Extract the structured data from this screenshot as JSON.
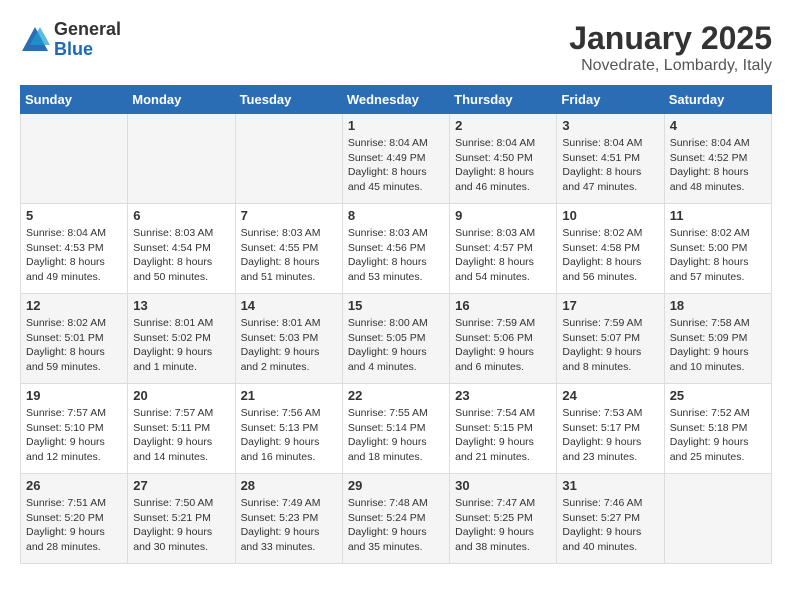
{
  "header": {
    "logo": {
      "general": "General",
      "blue": "Blue"
    },
    "title": "January 2025",
    "location": "Novedrate, Lombardy, Italy"
  },
  "weekdays": [
    "Sunday",
    "Monday",
    "Tuesday",
    "Wednesday",
    "Thursday",
    "Friday",
    "Saturday"
  ],
  "weeks": [
    [
      {
        "day": "",
        "info": ""
      },
      {
        "day": "",
        "info": ""
      },
      {
        "day": "",
        "info": ""
      },
      {
        "day": "1",
        "info": "Sunrise: 8:04 AM\nSunset: 4:49 PM\nDaylight: 8 hours\nand 45 minutes."
      },
      {
        "day": "2",
        "info": "Sunrise: 8:04 AM\nSunset: 4:50 PM\nDaylight: 8 hours\nand 46 minutes."
      },
      {
        "day": "3",
        "info": "Sunrise: 8:04 AM\nSunset: 4:51 PM\nDaylight: 8 hours\nand 47 minutes."
      },
      {
        "day": "4",
        "info": "Sunrise: 8:04 AM\nSunset: 4:52 PM\nDaylight: 8 hours\nand 48 minutes."
      }
    ],
    [
      {
        "day": "5",
        "info": "Sunrise: 8:04 AM\nSunset: 4:53 PM\nDaylight: 8 hours\nand 49 minutes."
      },
      {
        "day": "6",
        "info": "Sunrise: 8:03 AM\nSunset: 4:54 PM\nDaylight: 8 hours\nand 50 minutes."
      },
      {
        "day": "7",
        "info": "Sunrise: 8:03 AM\nSunset: 4:55 PM\nDaylight: 8 hours\nand 51 minutes."
      },
      {
        "day": "8",
        "info": "Sunrise: 8:03 AM\nSunset: 4:56 PM\nDaylight: 8 hours\nand 53 minutes."
      },
      {
        "day": "9",
        "info": "Sunrise: 8:03 AM\nSunset: 4:57 PM\nDaylight: 8 hours\nand 54 minutes."
      },
      {
        "day": "10",
        "info": "Sunrise: 8:02 AM\nSunset: 4:58 PM\nDaylight: 8 hours\nand 56 minutes."
      },
      {
        "day": "11",
        "info": "Sunrise: 8:02 AM\nSunset: 5:00 PM\nDaylight: 8 hours\nand 57 minutes."
      }
    ],
    [
      {
        "day": "12",
        "info": "Sunrise: 8:02 AM\nSunset: 5:01 PM\nDaylight: 8 hours\nand 59 minutes."
      },
      {
        "day": "13",
        "info": "Sunrise: 8:01 AM\nSunset: 5:02 PM\nDaylight: 9 hours\nand 1 minute."
      },
      {
        "day": "14",
        "info": "Sunrise: 8:01 AM\nSunset: 5:03 PM\nDaylight: 9 hours\nand 2 minutes."
      },
      {
        "day": "15",
        "info": "Sunrise: 8:00 AM\nSunset: 5:05 PM\nDaylight: 9 hours\nand 4 minutes."
      },
      {
        "day": "16",
        "info": "Sunrise: 7:59 AM\nSunset: 5:06 PM\nDaylight: 9 hours\nand 6 minutes."
      },
      {
        "day": "17",
        "info": "Sunrise: 7:59 AM\nSunset: 5:07 PM\nDaylight: 9 hours\nand 8 minutes."
      },
      {
        "day": "18",
        "info": "Sunrise: 7:58 AM\nSunset: 5:09 PM\nDaylight: 9 hours\nand 10 minutes."
      }
    ],
    [
      {
        "day": "19",
        "info": "Sunrise: 7:57 AM\nSunset: 5:10 PM\nDaylight: 9 hours\nand 12 minutes."
      },
      {
        "day": "20",
        "info": "Sunrise: 7:57 AM\nSunset: 5:11 PM\nDaylight: 9 hours\nand 14 minutes."
      },
      {
        "day": "21",
        "info": "Sunrise: 7:56 AM\nSunset: 5:13 PM\nDaylight: 9 hours\nand 16 minutes."
      },
      {
        "day": "22",
        "info": "Sunrise: 7:55 AM\nSunset: 5:14 PM\nDaylight: 9 hours\nand 18 minutes."
      },
      {
        "day": "23",
        "info": "Sunrise: 7:54 AM\nSunset: 5:15 PM\nDaylight: 9 hours\nand 21 minutes."
      },
      {
        "day": "24",
        "info": "Sunrise: 7:53 AM\nSunset: 5:17 PM\nDaylight: 9 hours\nand 23 minutes."
      },
      {
        "day": "25",
        "info": "Sunrise: 7:52 AM\nSunset: 5:18 PM\nDaylight: 9 hours\nand 25 minutes."
      }
    ],
    [
      {
        "day": "26",
        "info": "Sunrise: 7:51 AM\nSunset: 5:20 PM\nDaylight: 9 hours\nand 28 minutes."
      },
      {
        "day": "27",
        "info": "Sunrise: 7:50 AM\nSunset: 5:21 PM\nDaylight: 9 hours\nand 30 minutes."
      },
      {
        "day": "28",
        "info": "Sunrise: 7:49 AM\nSunset: 5:23 PM\nDaylight: 9 hours\nand 33 minutes."
      },
      {
        "day": "29",
        "info": "Sunrise: 7:48 AM\nSunset: 5:24 PM\nDaylight: 9 hours\nand 35 minutes."
      },
      {
        "day": "30",
        "info": "Sunrise: 7:47 AM\nSunset: 5:25 PM\nDaylight: 9 hours\nand 38 minutes."
      },
      {
        "day": "31",
        "info": "Sunrise: 7:46 AM\nSunset: 5:27 PM\nDaylight: 9 hours\nand 40 minutes."
      },
      {
        "day": "",
        "info": ""
      }
    ]
  ]
}
